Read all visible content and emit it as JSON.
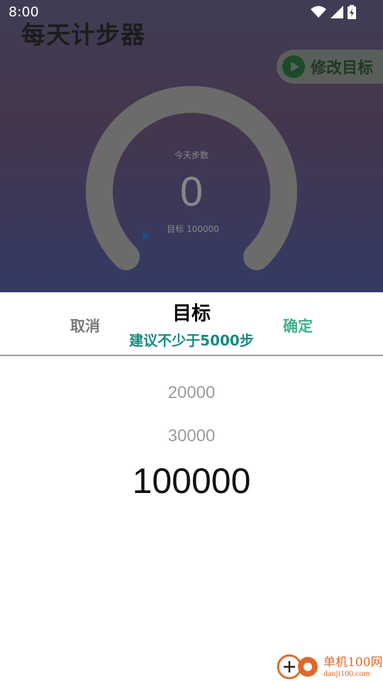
{
  "status_bar": {
    "time": "8:00"
  },
  "app": {
    "title": "每天计步器",
    "edit_goal_label": "修改目标",
    "gauge": {
      "label": "今天步数",
      "steps": "0",
      "target_label": "目标",
      "target_value": "100000"
    }
  },
  "picker": {
    "cancel_label": "取消",
    "title": "目标",
    "subtitle": "建议不少于5000步",
    "confirm_label": "确定",
    "options": [
      "20000",
      "30000",
      "100000"
    ],
    "selected_index": 2
  },
  "watermark": {
    "cn": "单机100网",
    "en": "danji100.com"
  },
  "colors": {
    "confirm": "#3fb08b",
    "subtitle": "#1a8a84",
    "watermark": "#e0692a"
  }
}
